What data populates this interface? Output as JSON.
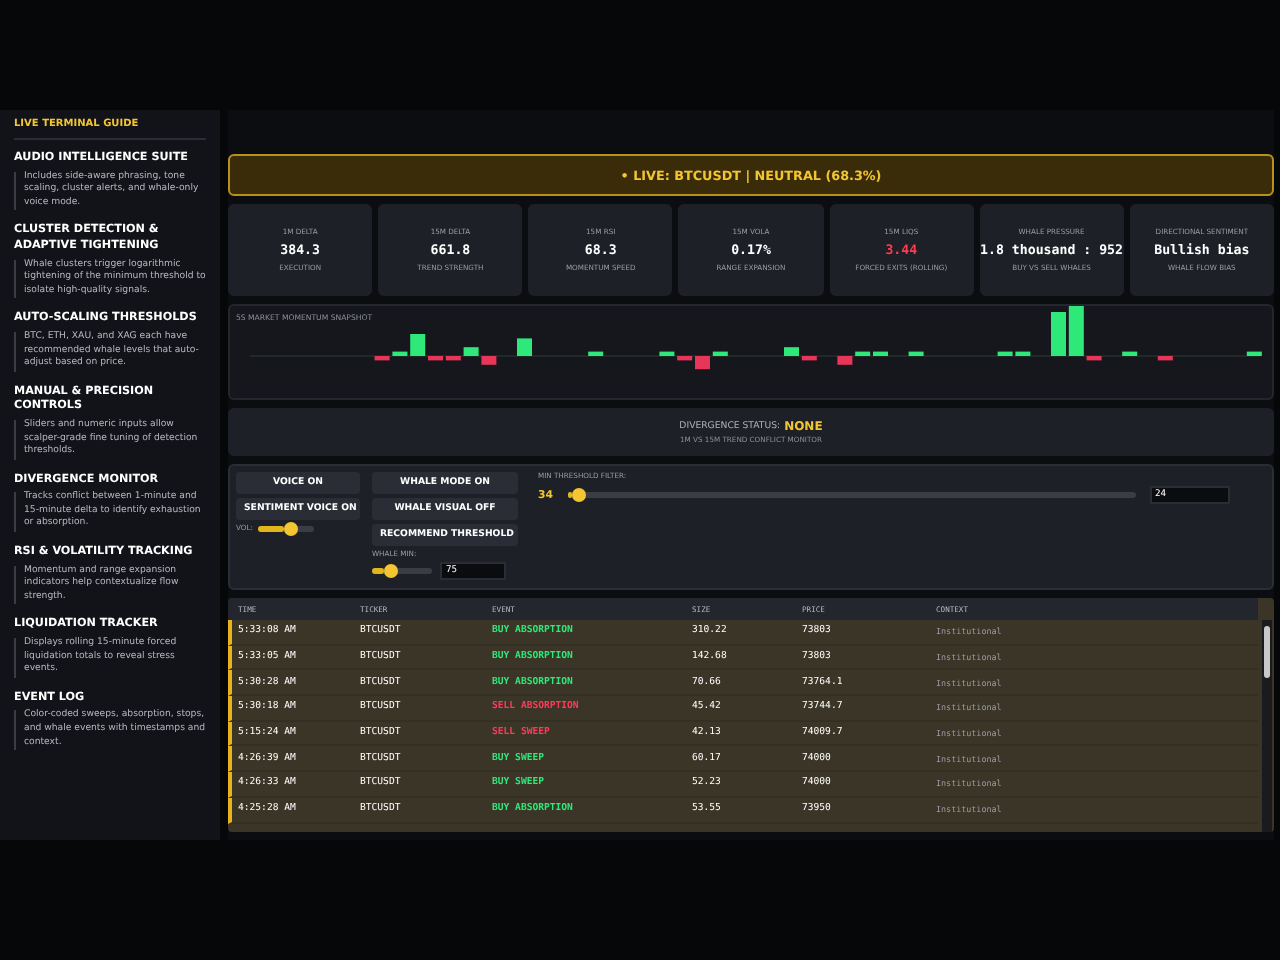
{
  "guide": {
    "title": "LIVE TERMINAL GUIDE",
    "sections": [
      {
        "heading": "AUDIO INTELLIGENCE SUITE",
        "text": "Includes side-aware phrasing, tone scaling, cluster alerts, and whale-only voice mode."
      },
      {
        "heading": "CLUSTER DETECTION & ADAPTIVE TIGHTENING",
        "text": "Whale clusters trigger logarithmic tightening of the minimum threshold to isolate high-quality signals."
      },
      {
        "heading": "AUTO-SCALING THRESHOLDS",
        "text": "BTC, ETH, XAU, and XAG each have recommended whale levels that auto-adjust based on price."
      },
      {
        "heading": "MANUAL & PRECISION CONTROLS",
        "text": "Sliders and numeric inputs allow scalper-grade fine tuning of detection thresholds."
      },
      {
        "heading": "DIVERGENCE MONITOR",
        "text": "Tracks conflict between 1-minute and 15-minute delta to identify exhaustion or absorption."
      },
      {
        "heading": "RSI & VOLATILITY TRACKING",
        "text": "Momentum and range expansion indicators help contextualize flow strength."
      },
      {
        "heading": "LIQUIDATION TRACKER",
        "text": "Displays rolling 15-minute forced liquidation totals to reveal stress events."
      },
      {
        "heading": "EVENT LOG",
        "text": "Color-coded sweeps, absorption, stops, and whale events with timestamps and context."
      }
    ]
  },
  "banner": {
    "text": "• LIVE: BTCUSDT | NEUTRAL (68.3%)"
  },
  "metrics": [
    {
      "label": "1M DELTA",
      "value": "384.3",
      "sub": "EXECUTION",
      "color": "#ffffff"
    },
    {
      "label": "15M DELTA",
      "value": "661.8",
      "sub": "TREND STRENGTH",
      "color": "#ffffff"
    },
    {
      "label": "15M RSI",
      "value": "68.3",
      "sub": "MOMENTUM SPEED",
      "color": "#ffffff"
    },
    {
      "label": "15M VOLA",
      "value": "0.17%",
      "sub": "RANGE EXPANSION",
      "color": "#ffffff"
    },
    {
      "label": "15M LIQS",
      "value": "3.44",
      "sub": "FORCED EXITS (ROLLING)",
      "color": "#ff3b4f"
    },
    {
      "label": "WHALE PRESSURE",
      "value": "1.8 thousand : 952",
      "sub": "BUY VS SELL WHALES",
      "color": "#ffffff"
    },
    {
      "label": "DIRECTIONAL SENTIMENT",
      "value": "Bullish bias",
      "sub": "WHALE FLOW BIAS",
      "color": "#ffffff"
    }
  ],
  "momentum": {
    "title": "5S MARKET MOMENTUM SNAPSHOT"
  },
  "divergence": {
    "label": "DIVERGENCE STATUS:",
    "status": "NONE",
    "sub": "1M VS 15M TREND CONFLICT MONITOR"
  },
  "controls": {
    "voice_buttons": [
      "VOICE ON",
      "SENTIMENT VOICE ON"
    ],
    "volume": {
      "label": "VOL:",
      "level": 0.45
    },
    "whale_buttons": [
      "WHALE MODE ON",
      "WHALE VISUAL OFF",
      "RECOMMEND THRESHOLD"
    ],
    "whale_min": {
      "label": "WHALE MIN:",
      "level": 0.2,
      "value": "75"
    },
    "threshold": {
      "label": "MIN THRESHOLD FILTER:",
      "reading": "34",
      "level": 0.01,
      "value": "24"
    }
  },
  "event_log": {
    "columns": [
      "TIME",
      "TICKER",
      "EVENT",
      "SIZE",
      "PRICE",
      "CONTEXT"
    ],
    "rows": [
      {
        "time": "5:33:08 AM",
        "ticker": "BTCUSDT",
        "event": "BUY ABSORPTION",
        "color": "#2ee87a",
        "size": "310.22",
        "price": "73803",
        "context": "Institutional"
      },
      {
        "time": "5:33:05 AM",
        "ticker": "BTCUSDT",
        "event": "BUY ABSORPTION",
        "color": "#2ee87a",
        "size": "142.68",
        "price": "73803",
        "context": "Institutional"
      },
      {
        "time": "5:30:28 AM",
        "ticker": "BTCUSDT",
        "event": "BUY ABSORPTION",
        "color": "#2ee87a",
        "size": "70.66",
        "price": "73764.1",
        "context": "Institutional"
      },
      {
        "time": "5:30:18 AM",
        "ticker": "BTCUSDT",
        "event": "SELL ABSORPTION",
        "color": "#ff3b5c",
        "size": "45.42",
        "price": "73744.7",
        "context": "Institutional"
      },
      {
        "time": "5:15:24 AM",
        "ticker": "BTCUSDT",
        "event": "SELL SWEEP",
        "color": "#ff3b5c",
        "size": "42.13",
        "price": "74009.7",
        "context": "Institutional"
      },
      {
        "time": "4:26:39 AM",
        "ticker": "BTCUSDT",
        "event": "BUY SWEEP",
        "color": "#2ee87a",
        "size": "60.17",
        "price": "74000",
        "context": "Institutional"
      },
      {
        "time": "4:26:33 AM",
        "ticker": "BTCUSDT",
        "event": "BUY SWEEP",
        "color": "#2ee87a",
        "size": "52.23",
        "price": "74000",
        "context": "Institutional"
      },
      {
        "time": "4:25:28 AM",
        "ticker": "BTCUSDT",
        "event": "BUY ABSORPTION",
        "color": "#2ee87a",
        "size": "53.55",
        "price": "73950",
        "context": "Institutional"
      }
    ]
  }
}
